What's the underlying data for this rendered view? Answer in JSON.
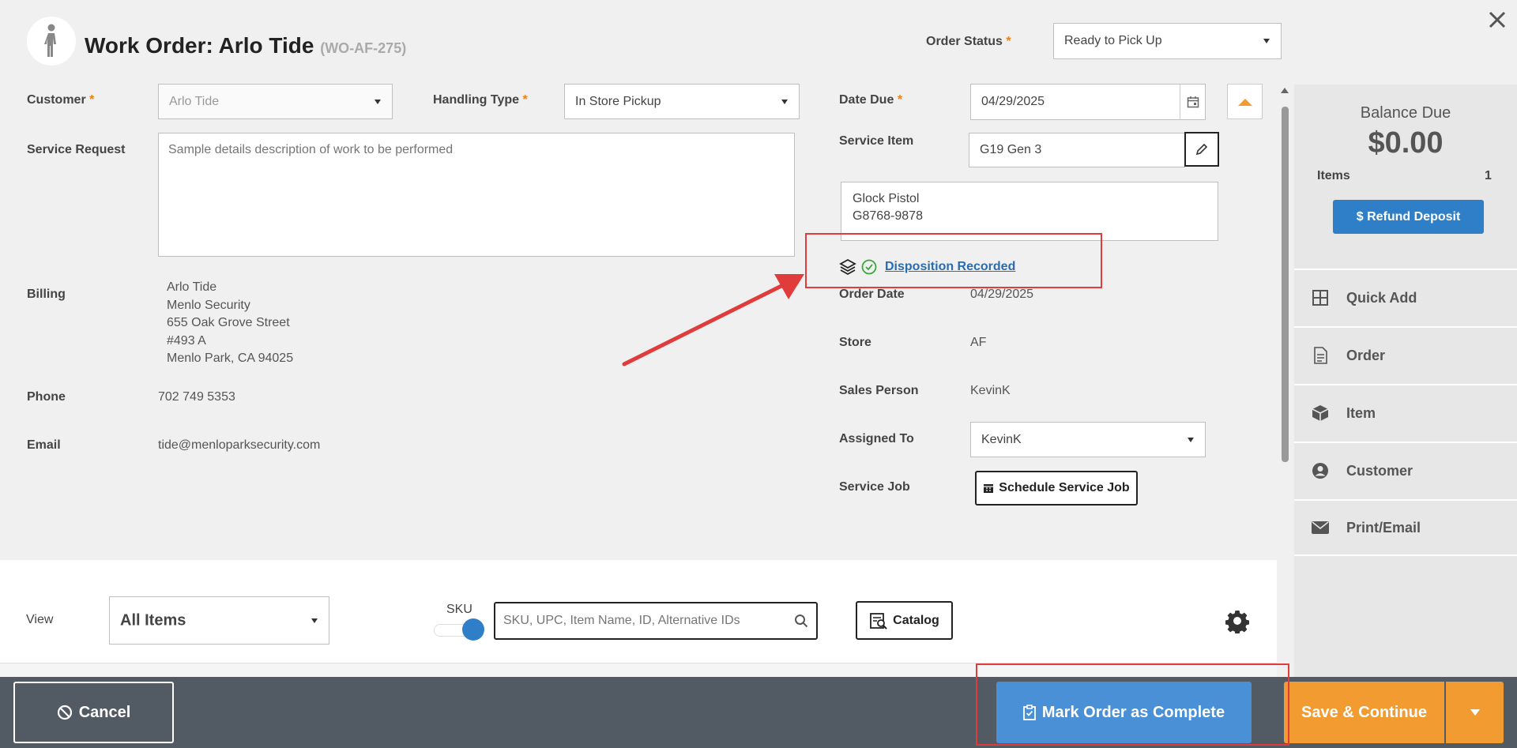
{
  "header": {
    "title": "Work Order: Arlo Tide",
    "order_id": "(WO-AF-275)",
    "order_status_label": "Order Status",
    "order_status_value": "Ready to Pick Up"
  },
  "form": {
    "customer_label": "Customer",
    "customer_value": "Arlo Tide",
    "handling_type_label": "Handling Type",
    "handling_type_value": "In Store Pickup",
    "service_request_label": "Service Request",
    "service_request_placeholder": "Sample details description of work to be performed",
    "billing_label": "Billing",
    "billing_lines": [
      "Arlo Tide",
      "Menlo Security",
      "655 Oak Grove Street",
      "#493 A",
      "Menlo Park, CA 94025"
    ],
    "phone_label": "Phone",
    "phone_value": "702 749 5353",
    "email_label": "Email",
    "email_value": "tide@menloparksecurity.com",
    "date_due_label": "Date Due",
    "date_due_value": "04/29/2025",
    "service_item_label": "Service Item",
    "service_item_value": "G19 Gen 3",
    "service_item_detail_lines": [
      "Glock Pistol",
      "G8768-9878"
    ],
    "disposition_link": "Disposition Recorded",
    "order_date_label": "Order Date",
    "order_date_value": "04/29/2025",
    "store_label": "Store",
    "store_value": "AF",
    "sales_person_label": "Sales Person",
    "sales_person_value": "KevinK",
    "assigned_to_label": "Assigned To",
    "assigned_to_value": "KevinK",
    "service_job_label": "Service Job",
    "schedule_button": "Schedule Service Job"
  },
  "sidebar": {
    "balance_due_label": "Balance Due",
    "balance_due_value": "$0.00",
    "items_label": "Items",
    "items_count": "1",
    "refund_button": "$ Refund Deposit",
    "nav": [
      {
        "label": "Quick Add",
        "icon": "grid-icon"
      },
      {
        "label": "Order",
        "icon": "document-icon"
      },
      {
        "label": "Item",
        "icon": "box-icon"
      },
      {
        "label": "Customer",
        "icon": "user-circle-icon"
      },
      {
        "label": "Print/Email",
        "icon": "envelope-icon"
      }
    ]
  },
  "items_bar": {
    "view_label": "View",
    "view_value": "All Items",
    "sku_label": "SKU",
    "search_placeholder": "SKU, UPC, Item Name, ID, Alternative IDs",
    "catalog_button": "Catalog"
  },
  "footer": {
    "cancel": "Cancel",
    "complete": "Mark Order as Complete",
    "save": "Save & Continue"
  },
  "colors": {
    "accent_blue": "#4a90d6",
    "accent_orange": "#f29b30",
    "annotation_red": "#e03c3c",
    "footer_bg": "#525a63"
  }
}
